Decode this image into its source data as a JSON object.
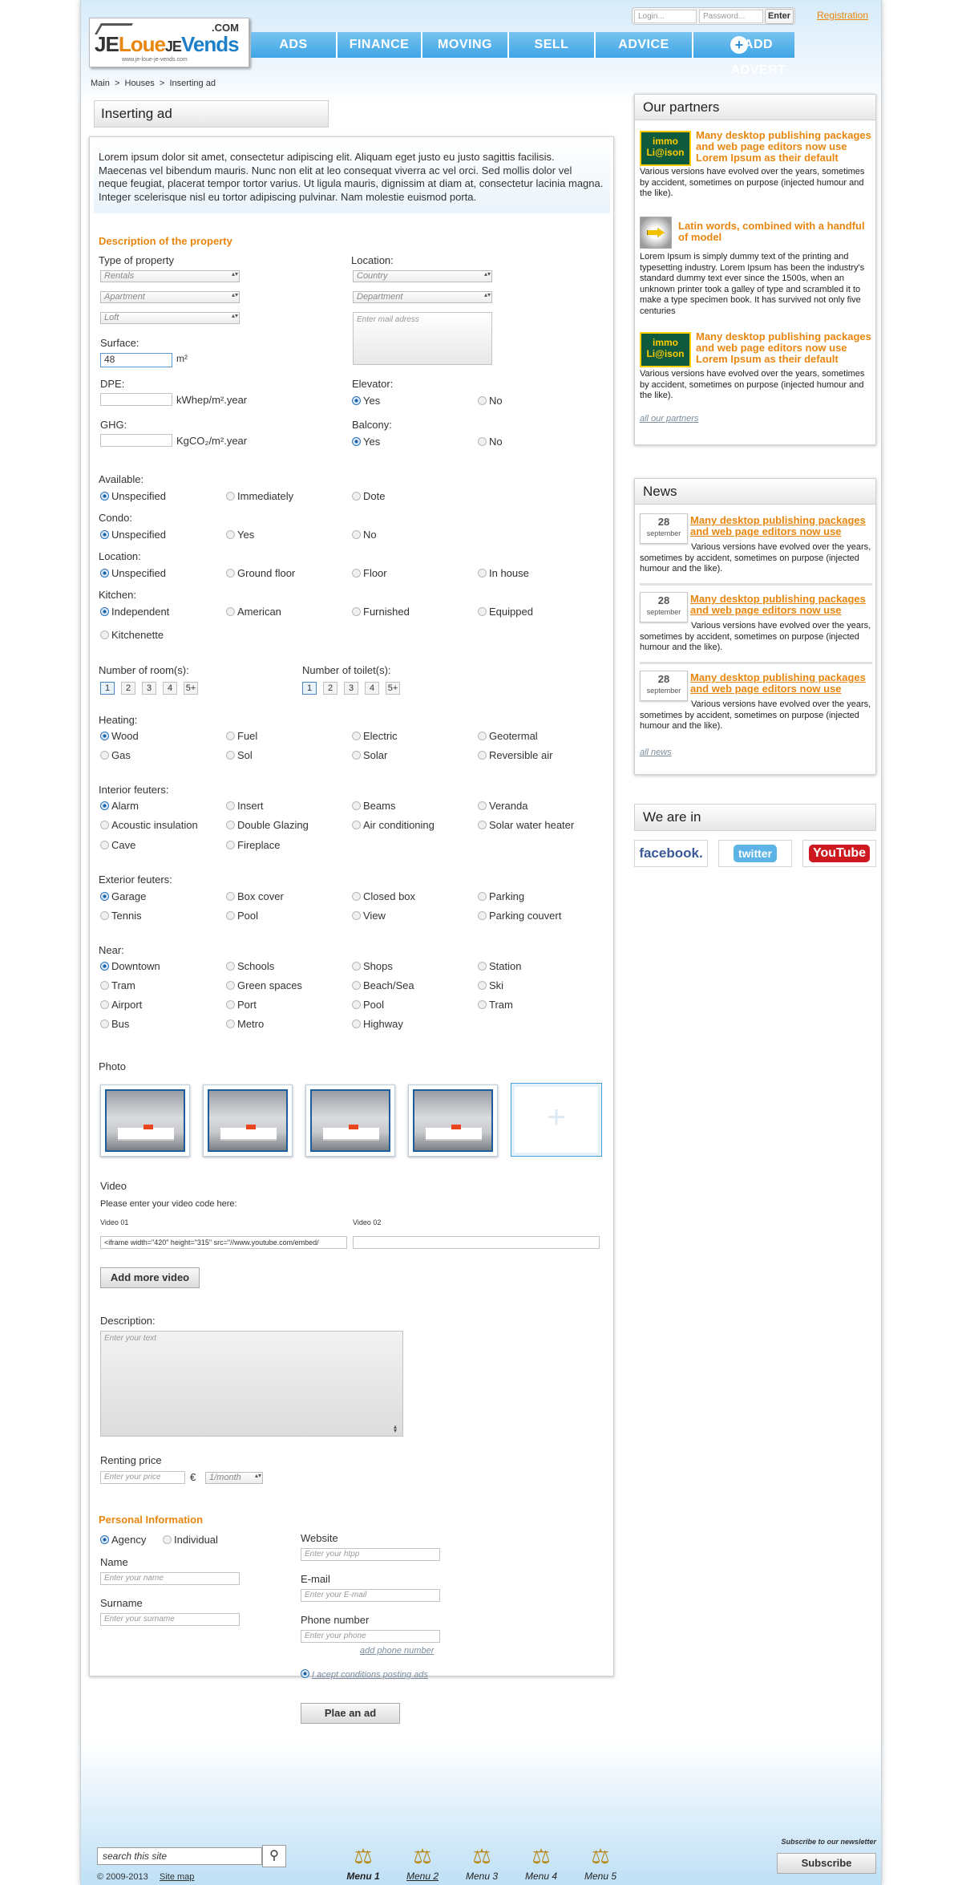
{
  "header": {
    "logo": {
      "word_je1": "JE",
      "word_loue": "Loue",
      "word_je2": "JE",
      "word_vends": "Vends",
      "domain": ".COM",
      "tagline": "www.je-loue-je-vends.com"
    },
    "login_placeholder": "Login...",
    "password_placeholder": "Password...",
    "enter_label": "Enter",
    "registration": "Registration",
    "nav": [
      "ADS",
      "FINANCE",
      "MOVING",
      "SELL",
      "ADVICE"
    ],
    "add_advert": "ADD ADVERT",
    "breadcrumb": [
      "Main",
      "Houses",
      "Inserting ad"
    ]
  },
  "main": {
    "title": "Inserting ad",
    "intro": "Lorem ipsum dolor sit amet, consectetur adipiscing elit. Aliquam eget justo eu justo sagittis facilisis. Maecenas vel bibendum mauris. Nunc non elit at leo consequat viverra ac vel orci. Sed mollis dolor vel neque feugiat, placerat tempor tortor varius. Ut ligula mauris, dignissim at diam at, consectetur lacinia magna. Integer scelerisque nisl eu tortor adipiscing pulvinar. Nam molestie euismod porta.",
    "desc_heading": "Description of the property",
    "type_label": "Type of property",
    "type_selects": [
      "Rentals",
      "Apartment",
      "Loft"
    ],
    "location_label": "Location:",
    "location_selects": [
      "Country",
      "Department"
    ],
    "mail_placeholder": "Enter mail adress",
    "surface_label": "Surface:",
    "surface_value": "48",
    "surface_unit": "m²",
    "dpe_label": "DPE:",
    "dpe_unit": "kWhep/m².year",
    "ghg_label": "GHG:",
    "ghg_unit": "KgCO₂/m².year",
    "elevator_label": "Elevator:",
    "balcony_label": "Balcony:",
    "yes": "Yes",
    "no": "No",
    "available_label": "Available:",
    "available": [
      "Unspecified",
      "Immediately",
      "Dote"
    ],
    "condo_label": "Condo:",
    "condo": [
      "Unspecified",
      "Yes",
      "No"
    ],
    "location2_label": "Location:",
    "location2": [
      "Unspecified",
      "Ground floor",
      "Floor",
      "In house"
    ],
    "kitchen_label": "Kitchen:",
    "kitchen": [
      "Independent",
      "American",
      "Furnished",
      "Equipped",
      "Kitchenette"
    ],
    "rooms_label": "Number of room(s):",
    "toilets_label": "Number of toilet(s):",
    "numbers": [
      "1",
      "2",
      "3",
      "4",
      "5+"
    ],
    "heating_label": "Heating:",
    "heating": [
      "Wood",
      "Fuel",
      "Electric",
      "Geotermal",
      "Gas",
      "Sol",
      "Solar",
      "Reversible air"
    ],
    "interior_label": "Interior feuters:",
    "interior": [
      "Alarm",
      "Insert",
      "Beams",
      "Veranda",
      "Acoustic insulation",
      "Double Glazing",
      "Air conditioning",
      "Solar water heater",
      "Cave",
      "Fireplace"
    ],
    "exterior_label": "Exterior feuters:",
    "exterior": [
      "Garage",
      "Box cover",
      "Closed box",
      "Parking",
      "Tennis",
      "Pool",
      "View",
      "Parking couvert"
    ],
    "near_label": "Near:",
    "near": [
      "Downtown",
      "Schools",
      "Shops",
      "Station",
      "Tram",
      "Green spaces",
      "Beach/Sea",
      "Ski",
      "Airport",
      "Port",
      "Pool",
      "Tram",
      "Bus",
      "Metro",
      "Highway"
    ],
    "photo_label": "Photo",
    "add_photo_icon": "+",
    "video_label": "Video",
    "video_hint": "Please enter your video code here:",
    "video01_label": "Video 01",
    "video01_value": "<iframe width=\"420\" height=\"315\" src=\"//www.youtube.com/embed/",
    "video02_label": "Video 02",
    "add_video": "Add more video",
    "description_label": "Description:",
    "description_placeholder": "Enter your text",
    "price_label": "Renting price",
    "price_placeholder": "Enter your price",
    "currency": "€",
    "period": "1/month",
    "personal_heading": "Personal Information",
    "agency": "Agency",
    "individual": "Individual",
    "name_label": "Name",
    "name_placeholder": "Enter your name",
    "surname_label": "Surname",
    "surname_placeholder": "Enter your surname",
    "website_label": "Website",
    "website_placeholder": "Enter your htpp",
    "email_label": "E-mail",
    "email_placeholder": "Enter your E-mail",
    "phone_label": "Phone number",
    "phone_placeholder": "Enter your phone",
    "add_phone": "add phone number",
    "accept": "I acept conditions posting ads",
    "submit": "Plae an ad"
  },
  "sidebar": {
    "partners_title": "Our partners",
    "partner_logo": [
      "immo",
      "Li@ison"
    ],
    "partners": [
      {
        "title": "Many desktop publishing packages and web page editors now use Lorem Ipsum as their default",
        "text": "Various versions have evolved over the years, sometimes by accident, sometimes on purpose (injected humour and the like)."
      },
      {
        "title": "Latin words, combined with a handful of model",
        "text": "Lorem Ipsum is simply dummy text of the printing and typesetting industry. Lorem Ipsum has been the industry's standard dummy text ever since the 1500s, when an unknown printer took a galley of type and scrambled it to make a type specimen book. It has survived not only five centuries"
      },
      {
        "title": "Many desktop publishing packages and web page editors now use Lorem Ipsum as their default",
        "text": "Various versions have evolved over the years, sometimes by accident, sometimes on purpose (injected humour and the like)."
      }
    ],
    "all_partners": "all our partners",
    "news_title": "News",
    "news": [
      {
        "day": "28",
        "month": "september",
        "title": "Many desktop publishing packages and web page editors now use",
        "text": "Various versions have evolved over the years, sometimes by accident, sometimes on purpose (injected humour and the like)."
      },
      {
        "day": "28",
        "month": "september",
        "title": "Many desktop publishing packages and web page editors now use",
        "text": "Various versions have evolved over the years, sometimes by accident, sometimes on purpose (injected humour and the like)."
      },
      {
        "day": "28",
        "month": "september",
        "title": "Many desktop publishing packages and web page editors now use",
        "text": "Various versions have evolved over the years, sometimes by accident, sometimes on purpose (injected humour and the like)."
      }
    ],
    "all_news": "all news",
    "we_are_in": "We are in",
    "social": [
      "facebook.",
      "twitter",
      "YouTube"
    ],
    "colors": {
      "facebook": "#3b5998",
      "twitter": "#5bb3e6",
      "youtube": "#cc181e"
    }
  },
  "footer": {
    "search_value": "search this site",
    "search_icon": "search-icon",
    "menus": [
      "Menu 1",
      "Menu 2",
      "Menu 3",
      "Menu 4",
      "Menu 5"
    ],
    "copyright": "© 2009-2013",
    "sitemap": "Site map",
    "newsletter": "Subscribe to our newsletter",
    "subscribe": "Subscribe"
  },
  "colors": {
    "accent": "#e8860f",
    "nav": "#4aaee8"
  }
}
